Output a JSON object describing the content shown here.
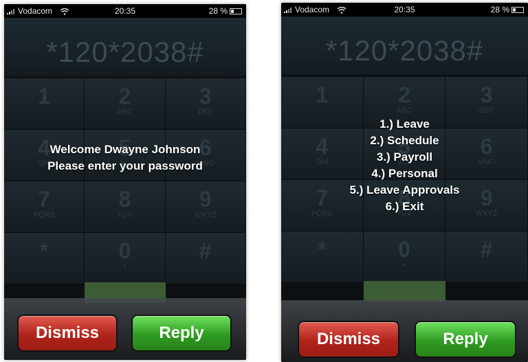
{
  "left": {
    "status": {
      "carrier": "Vodacom",
      "time": "20:35",
      "battery": "28 %"
    },
    "dialed": "*120*2038#",
    "keys": [
      {
        "num": "1",
        "letters": ""
      },
      {
        "num": "2",
        "letters": "ABC"
      },
      {
        "num": "3",
        "letters": "DEF"
      },
      {
        "num": "4",
        "letters": "GHI"
      },
      {
        "num": "5",
        "letters": "JKL"
      },
      {
        "num": "6",
        "letters": "MNO"
      },
      {
        "num": "7",
        "letters": "PQRS"
      },
      {
        "num": "8",
        "letters": "TUV"
      },
      {
        "num": "9",
        "letters": "WXYZ"
      },
      {
        "num": "*",
        "letters": ""
      },
      {
        "num": "0",
        "letters": "+"
      },
      {
        "num": "#",
        "letters": ""
      }
    ],
    "message": [
      "Welcome Dwayne  Johnson",
      "Please enter your password"
    ],
    "buttons": {
      "dismiss": "Dismiss",
      "reply": "Reply"
    }
  },
  "right": {
    "status": {
      "carrier": "Vodacom",
      "time": "20:35",
      "battery": "28 %"
    },
    "dialed": "*120*2038#",
    "keys": [
      {
        "num": "1",
        "letters": ""
      },
      {
        "num": "2",
        "letters": "ABC"
      },
      {
        "num": "3",
        "letters": "DEF"
      },
      {
        "num": "4",
        "letters": "GHI"
      },
      {
        "num": "5",
        "letters": "JKL"
      },
      {
        "num": "6",
        "letters": "MNO"
      },
      {
        "num": "7",
        "letters": "PQRS"
      },
      {
        "num": "8",
        "letters": "TUV"
      },
      {
        "num": "9",
        "letters": "WXYZ"
      },
      {
        "num": "*",
        "letters": ""
      },
      {
        "num": "0",
        "letters": "+"
      },
      {
        "num": "#",
        "letters": ""
      }
    ],
    "menu": [
      "1.) Leave",
      "2.) Schedule",
      "3.) Payroll",
      "4.) Personal",
      "5.) Leave Approvals",
      "6.) Exit"
    ],
    "buttons": {
      "dismiss": "Dismiss",
      "reply": "Reply"
    }
  },
  "colors": {
    "dismiss": "#b0231a",
    "reply": "#2f9b22",
    "background": "#0d1012"
  }
}
